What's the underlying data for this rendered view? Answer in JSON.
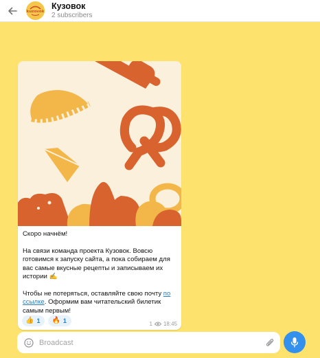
{
  "header": {
    "back_icon": "arrow-left-icon",
    "channel_name": "Кузовок",
    "avatar_logo_text": "kuzovok",
    "subscribers": "2 subscribers"
  },
  "message": {
    "paragraphs": {
      "p1": "Скоро начнём!",
      "p2": "На связи команда проекта Кузовок. Вовсю готовимся к запуску сайта, а пока собираем для вас самые вкусные рецепты и записываем их истории ✍",
      "p3_before": "Чтобы не потеряться, оставляйте свою почту ",
      "p3_link": "по ссылке",
      "p3_after": ". Оформим вам читательский билетик самым первым!"
    },
    "reactions": [
      {
        "emoji": "👍",
        "count": "1"
      },
      {
        "emoji": "🔥",
        "count": "1"
      }
    ],
    "views": "1",
    "time": "18:45"
  },
  "composer": {
    "placeholder": "Broadcast",
    "emoji_icon": "smile-icon",
    "attach_icon": "paperclip-icon",
    "send_icon": "microphone-icon"
  },
  "colors": {
    "background": "#fde26e",
    "accent": "#3390ec",
    "link": "#2a7cc2",
    "illustration_bg": "#fbf0dc",
    "illustration_orange": "#d9632e",
    "illustration_yellow": "#f3b749"
  }
}
